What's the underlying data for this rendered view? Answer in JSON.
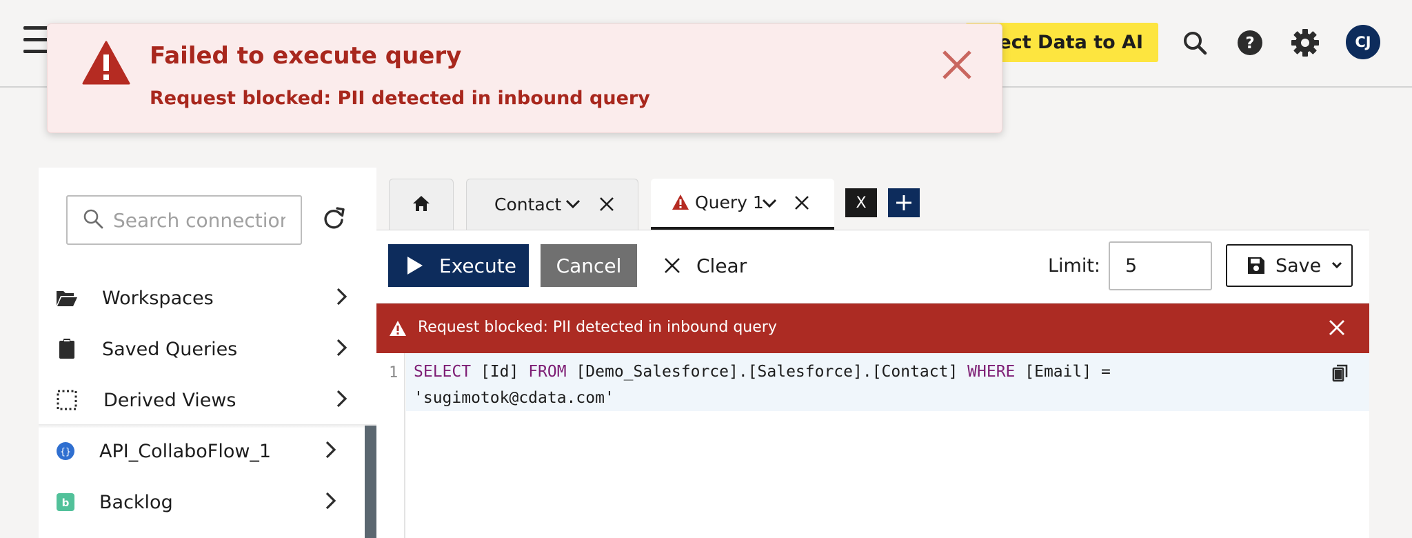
{
  "header": {
    "connect_button": "nnect Data to AI",
    "avatar_initials": "CJ"
  },
  "toast": {
    "title": "Failed to execute query",
    "message": "Request blocked: PII detected in inbound query"
  },
  "sidebar": {
    "search_placeholder": "Search connections",
    "nav": [
      {
        "label": "Workspaces",
        "icon": "folder-open-icon"
      },
      {
        "label": "Saved Queries",
        "icon": "clipboard-icon"
      },
      {
        "label": "Derived Views",
        "icon": "dashed-square-icon"
      }
    ],
    "connections": [
      {
        "label": "API_CollaboFlow_1",
        "icon": "api-icon"
      },
      {
        "label": "Backlog",
        "icon": "backlog-icon"
      }
    ]
  },
  "tabs": [
    {
      "label": "Contact"
    },
    {
      "label": "Query 1"
    }
  ],
  "tab_close_all": "X",
  "toolbar": {
    "execute": "Execute",
    "cancel": "Cancel",
    "clear": "Clear",
    "limit_label": "Limit:",
    "limit_value": "5",
    "save": "Save"
  },
  "error_bar": {
    "message": "Request blocked: PII detected in inbound query"
  },
  "editor": {
    "line_number": "1",
    "kw_select": "SELECT",
    "part_id": " [Id] ",
    "kw_from": "FROM",
    "part_table": " [Demo_Salesforce].[Salesforce].[Contact] ",
    "kw_where": "WHERE",
    "part_cond": " [Email] =",
    "line2": "'sugimotok@cdata.com'"
  },
  "colors": {
    "navy": "#0d2c5c",
    "error_red": "#ac2b23",
    "toast_text": "#a8271d",
    "accent_yellow": "#fde53f"
  }
}
